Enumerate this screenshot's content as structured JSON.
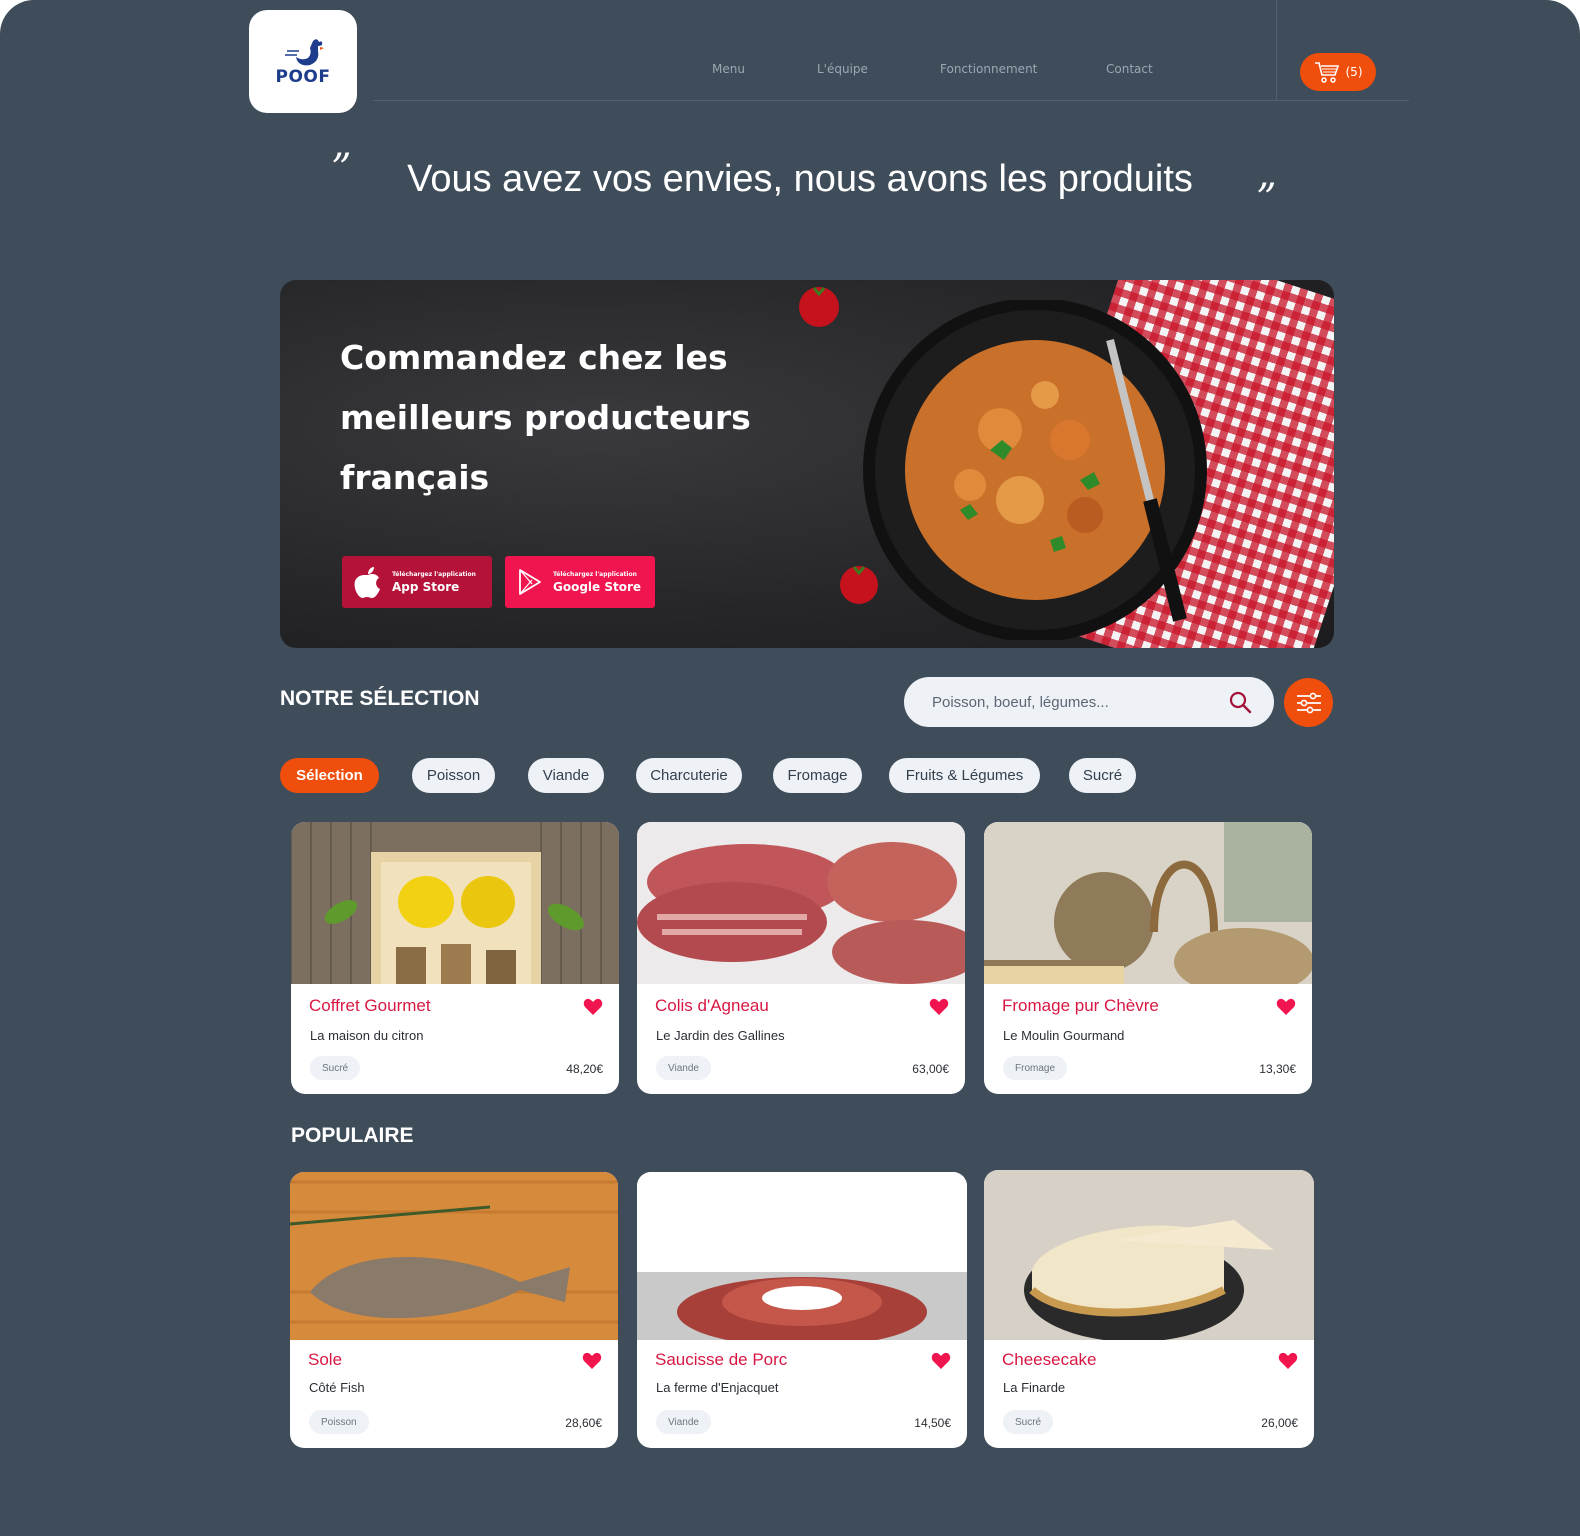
{
  "brand": {
    "logo_text": "POOF"
  },
  "nav": {
    "items": [
      "Menu",
      "L'équipe",
      "Fonctionnement",
      "Contact"
    ]
  },
  "cart": {
    "count_label": "(5)"
  },
  "hero": {
    "quote_open": "”",
    "quote_close": "”",
    "tagline": "Vous avez vos envies, nous avons les produits",
    "banner_title": "Commandez chez les meilleurs producteurs français",
    "app_store": {
      "small": "Téléchargez l'application",
      "big": "App Store",
      "color": "#b5123a"
    },
    "google_store": {
      "small": "Téléchargez l'application",
      "big": "Google Store",
      "color": "#f0154f"
    }
  },
  "selection": {
    "title": "NOTRE SÉLECTION",
    "search_placeholder": "Poisson, boeuf, légumes...",
    "categories": [
      "Sélection",
      "Poisson",
      "Viande",
      "Charcuterie",
      "Fromage",
      "Fruits & Légumes",
      "Sucré"
    ],
    "active_category": "Sélection",
    "products": [
      {
        "name": "Coffret Gourmet",
        "producer": "La maison du citron",
        "tag": "Sucré",
        "price": "48,20€"
      },
      {
        "name": "Colis d'Agneau",
        "producer": "Le Jardin des Gallines",
        "tag": "Viande",
        "price": "63,00€"
      },
      {
        "name": "Fromage pur Chèvre",
        "producer": "Le Moulin Gourmand",
        "tag": "Fromage",
        "price": "13,30€"
      }
    ]
  },
  "popular": {
    "title": "POPULAIRE",
    "products": [
      {
        "name": "Sole",
        "producer": "Côté Fish",
        "tag": "Poisson",
        "price": "28,60€"
      },
      {
        "name": "Saucisse de Porc",
        "producer": "La ferme d'Enjacquet",
        "tag": "Viande",
        "price": "14,50€"
      },
      {
        "name": "Cheesecake",
        "producer": "La Finarde",
        "tag": "Sucré",
        "price": "26,00€"
      }
    ]
  },
  "colors": {
    "background": "#3f4d5a",
    "accent": "#f04e0c",
    "product_name": "#d81843",
    "heart": "#f0154f"
  }
}
